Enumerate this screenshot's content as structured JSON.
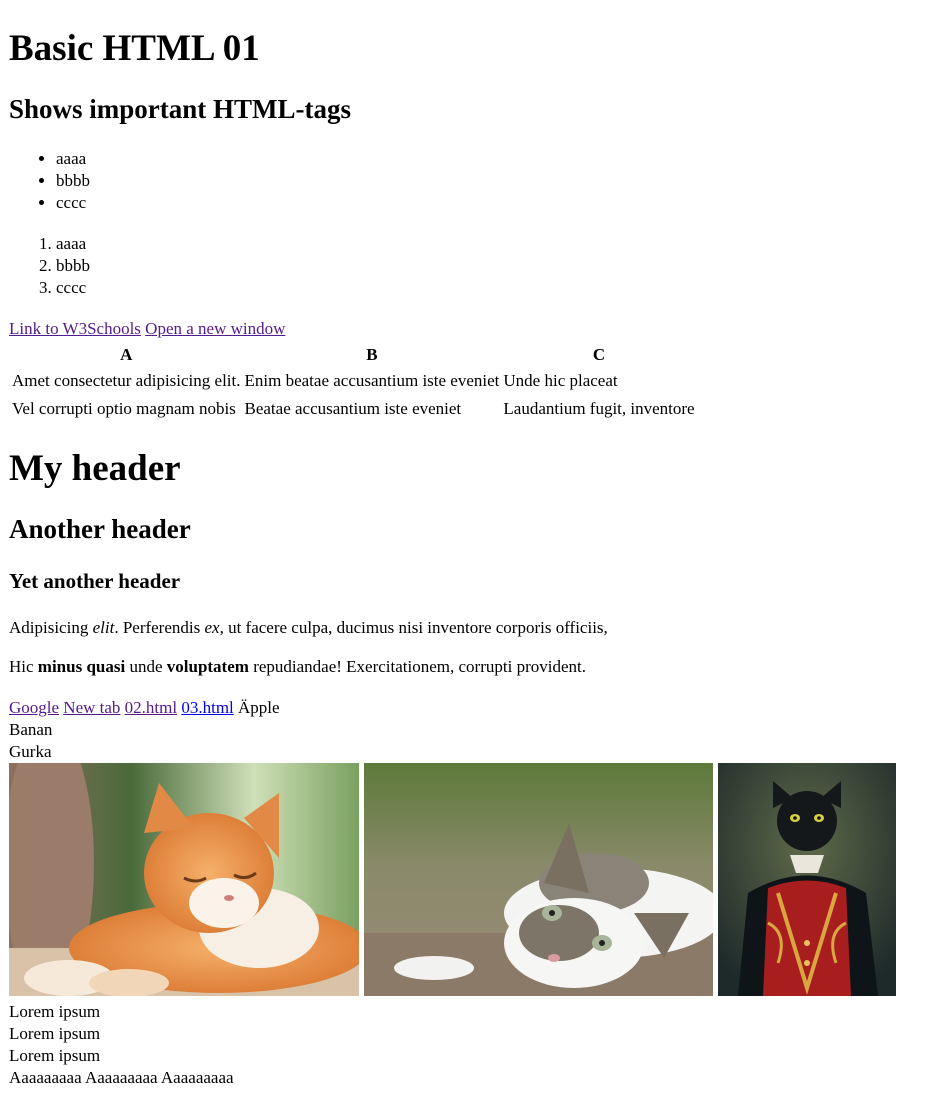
{
  "title": "Basic HTML 01",
  "subtitle": "Shows important HTML-tags",
  "unordered_list": [
    "aaaa",
    "bbbb",
    "cccc"
  ],
  "ordered_list": [
    "aaaa",
    "bbbb",
    "cccc"
  ],
  "links_row1": {
    "w3schools": "Link to W3Schools",
    "new_window": "Open a new window"
  },
  "table": {
    "headers": [
      "A",
      "B",
      "C"
    ],
    "rows": [
      [
        "Amet consectetur adipisicing elit.",
        "Enim beatae accusantium iste eveniet",
        "Unde hic placeat"
      ],
      [
        "Vel corrupti optio magnam nobis",
        "Beatae accusantium iste eveniet",
        "Laudantium fugit, inventore"
      ]
    ]
  },
  "headers": {
    "my_header": "My header",
    "another_header": "Another header",
    "yet_another_header": "Yet another header"
  },
  "paragraph1": {
    "part1": "Adipisicing ",
    "em1": "elit",
    "part2": ". Perferendis ",
    "em2": "ex",
    "part3": ", ut facere culpa, ducimus nisi inventore corporis officiis,"
  },
  "paragraph2": {
    "part1": "Hic ",
    "strong1": "minus quasi",
    "part2": " unde ",
    "strong2": "voluptatem",
    "part3": " repudiandae! Exercitationem, corrupti provident."
  },
  "links_row2": {
    "google": "Google",
    "new_tab": "New tab",
    "page02": "02.html",
    "page03": "03.html",
    "apple": "Äpple"
  },
  "fruit_lines": [
    "Banan",
    "Gurka"
  ],
  "images": [
    {
      "alt": "orange tabby cat sleeping in the sun",
      "icon": "cat-photo-orange"
    },
    {
      "alt": "white and grey cat lying on the ground",
      "icon": "cat-photo-grey"
    },
    {
      "alt": "black cat in an ornate red jacket painting",
      "icon": "cat-painting"
    }
  ],
  "footer_lines": [
    "Lorem ipsum",
    "Lorem ipsum",
    "Lorem ipsum",
    "Aaaaaaaaa Aaaaaaaaa Aaaaaaaaa"
  ],
  "colors": {
    "visited_link": "#551a8b",
    "unvisited_link": "#0000ee"
  }
}
